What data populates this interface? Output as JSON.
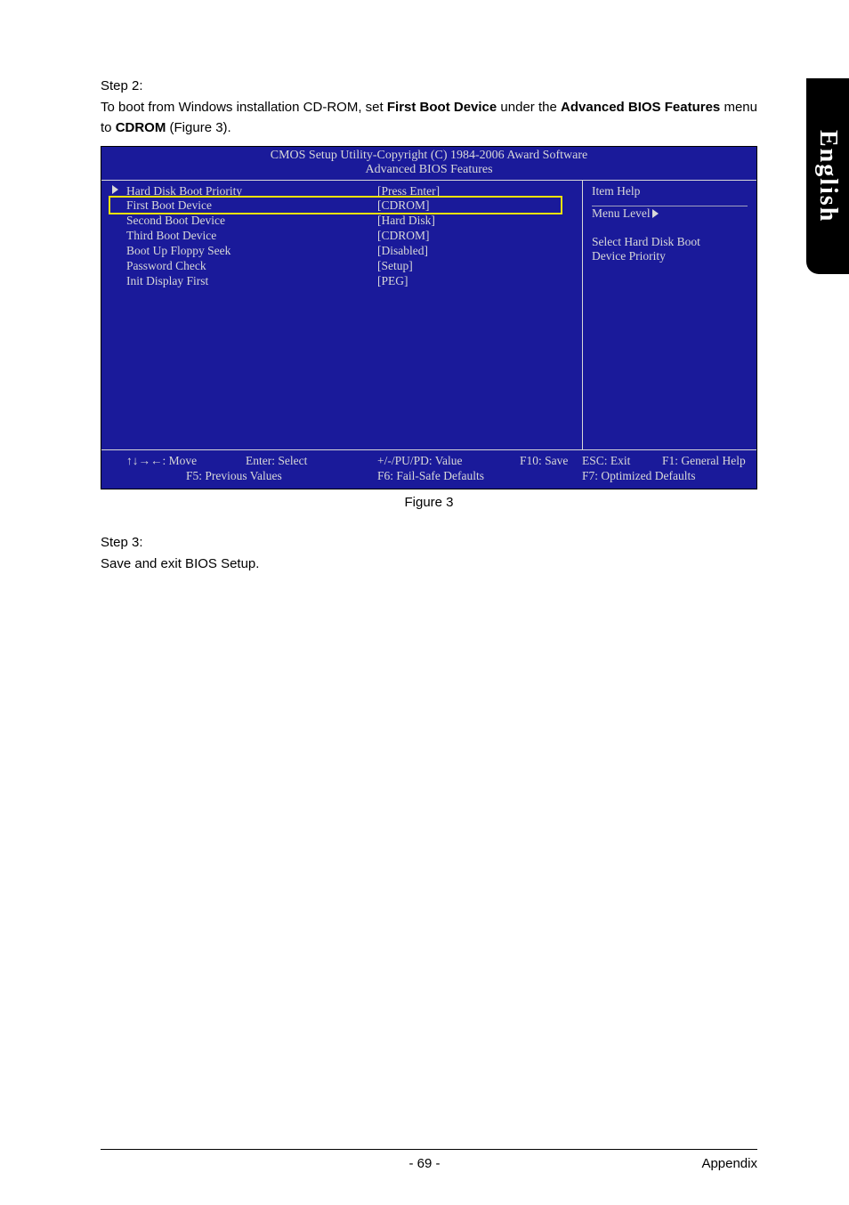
{
  "sideTab": "English",
  "step2": {
    "heading": "Step 2:",
    "text_pre": "To boot from Windows installation CD-ROM, set ",
    "bold1": "First Boot Device",
    "text_mid1": " under the ",
    "bold2": "Advanced BIOS Features",
    "text_mid2": " menu to ",
    "bold3": "CDROM",
    "text_post": " (Figure 3)."
  },
  "bios": {
    "title": "CMOS Setup Utility-Copyright (C) 1984-2006 Award Software",
    "subtitle": "Advanced BIOS Features",
    "rows": [
      {
        "label": "Hard Disk Boot Priority",
        "value": "[Press Enter]",
        "arrow": true
      },
      {
        "label": "First Boot Device",
        "value": "[CDROM]",
        "arrow": false
      },
      {
        "label": "Second Boot Device",
        "value": "[Hard Disk]",
        "arrow": false
      },
      {
        "label": "Third Boot Device",
        "value": "[CDROM]",
        "arrow": false
      },
      {
        "label": "Boot Up Floppy Seek",
        "value": "[Disabled]",
        "arrow": false
      },
      {
        "label": "Password Check",
        "value": "[Setup]",
        "arrow": false
      },
      {
        "label": "Init Display First",
        "value": "[PEG]",
        "arrow": false
      }
    ],
    "help": {
      "title": "Item Help",
      "menuLevel": "Menu Level",
      "desc1": "Select Hard Disk Boot",
      "desc2": "Device Priority"
    },
    "footer": {
      "move": "↑↓→←: Move",
      "enter": "Enter: Select",
      "value": "+/-/PU/PD: Value",
      "save": "F10: Save",
      "esc": "ESC: Exit",
      "help": "F1: General Help",
      "prev": "F5: Previous Values",
      "failsafe": "F6: Fail-Safe Defaults",
      "optimized": "F7: Optimized Defaults"
    }
  },
  "figureCaption": "Figure 3",
  "step3": {
    "heading": "Step 3:",
    "text": "Save and exit BIOS Setup."
  },
  "pageNumber": "- 69 -",
  "appendix": "Appendix"
}
